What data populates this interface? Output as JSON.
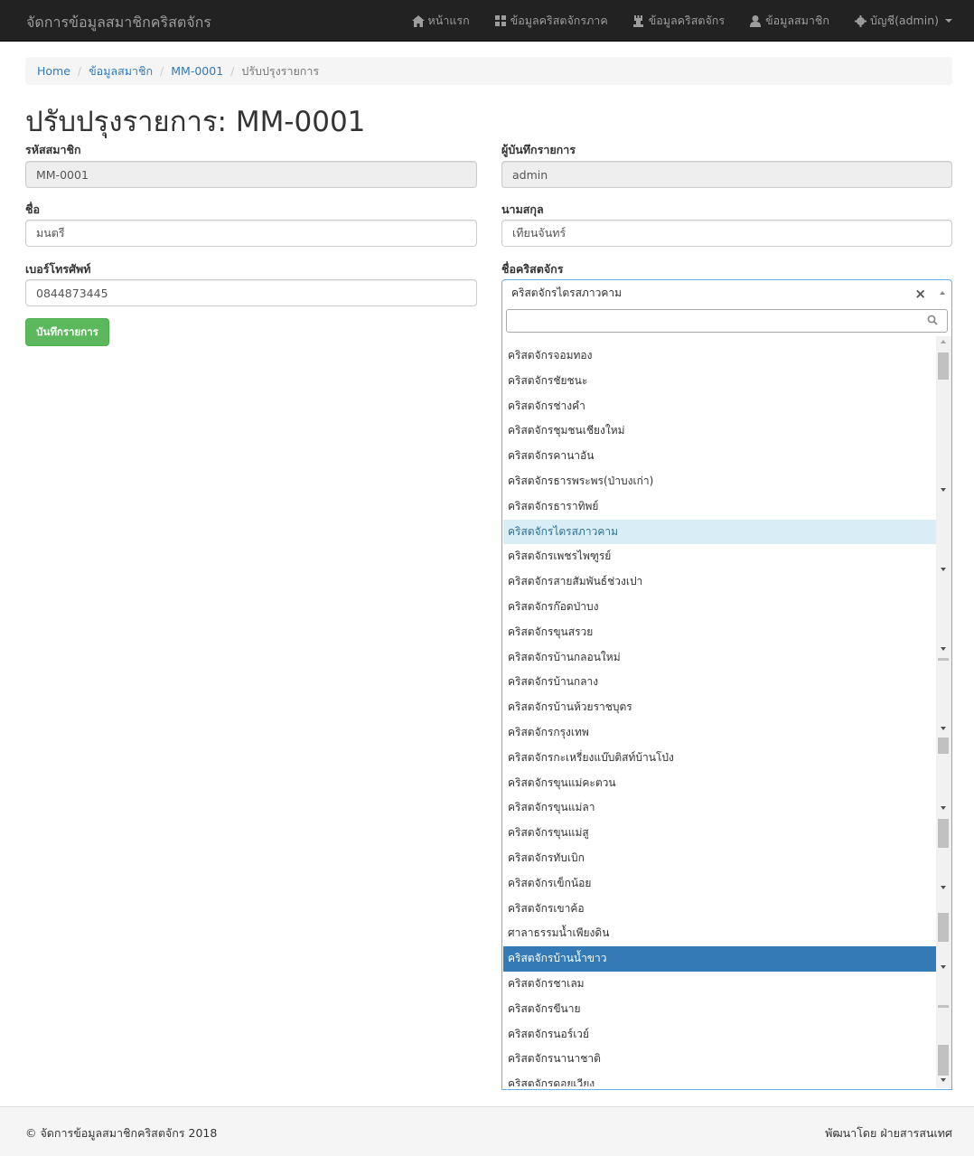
{
  "navbar": {
    "brand": "จัดการข้อมูลสมาชิกคริสตจักร",
    "items": [
      {
        "label": "หน้าแรก",
        "icon": "home-icon"
      },
      {
        "label": "ข้อมูลคริสตจักรภาค",
        "icon": "grid-icon"
      },
      {
        "label": "ข้อมูลคริสตจักร",
        "icon": "tower-icon"
      },
      {
        "label": "ข้อมูลสมาชิก",
        "icon": "user-icon"
      },
      {
        "label": "บัญชี(admin)",
        "icon": "cog-icon"
      }
    ]
  },
  "breadcrumb": {
    "home": "Home",
    "members": "ข้อมูลสมาชิก",
    "record": "MM-0001",
    "current": "ปรับปรุงรายการ",
    "separator": "/"
  },
  "page_title": "ปรับปรุงรายการ: MM-0001",
  "form": {
    "member_id_label": "รหัสสมาชิก",
    "member_id_value": "MM-0001",
    "recorder_label": "ผู้บันทึกรายการ",
    "recorder_value": "admin",
    "first_name_label": "ชื่อ",
    "first_name_value": "มนตรี",
    "last_name_label": "นามสกุล",
    "last_name_value": "เทียนจันทร์",
    "phone_label": "เบอร์โทรศัพท์",
    "phone_value": "0844873445",
    "church_label": "ชื่อคริสตจักร",
    "church_value": "คริสตจักรไตรสภาวคาม",
    "clear_symbol": "×",
    "save_button": "บันทึกรายการ"
  },
  "church_options": [
    "คริสตจักรจอมทอง",
    "คริสตจักรชัยชนะ",
    "คริสตจักรช่างคำ",
    "คริสตจักรชุมชนเชียงใหม่",
    "คริสตจักรคานาอัน",
    "คริสตจักรธารพระพร(ป่าบงเก่า)",
    "คริสตจักรธาราทิพย์",
    "คริสตจักรไตรสภาวคาม",
    "คริสตจักรเพชรไพฑูรย์",
    "คริสตจักรสายสัมพันธ์ช่วงเปา",
    "คริสตจักรก๊อดป่าบง",
    "คริสตจักรขุนสรวย",
    "คริสตจักรบ้านกลอนใหม่",
    "คริสตจักรบ้านกลาง",
    "คริสตจักรบ้านห้วยราชบุตร",
    "คริสตจักรกรุงเทพ",
    "คริสตจักรกะเหรี่ยงแบ๊บติสท์บ้านโป่ง",
    "คริสตจักรขุนแม่คะตวน",
    "คริสตจักรขุนแม่ลา",
    "คริสตจักรขุนแม่สู",
    "คริสตจักรทับเบิก",
    "คริสตจักรเข็กน้อย",
    "คริสตจักรเขาค้อ",
    "ศาลาธรรมน้ำเพียงดิน",
    "คริสตจักรบ้านน้ำขาว",
    "คริสตจักรชาเลม",
    "คริสตจักรขีนาย",
    "คริสตจักรนอร์เวย์",
    "คริสตจักรนานาชาติ",
    "คริสตจักรดอยเวียง"
  ],
  "highlighted_option": "คริสตจักรไตรสภาวคาม",
  "focused_option": "คริสตจักรบ้านน้ำขาว",
  "footer": {
    "left": "© จัดการข้อมูลสมาชิกคริสตจักร 2018",
    "right": "พัฒนาโดย ฝ่ายสารสนเทศ"
  },
  "colors": {
    "navbar_bg": "#222222",
    "link": "#337ab7",
    "save_button": "#5cb85c",
    "option_highlight": "#d9edf7",
    "option_selected": "#337ab7",
    "focus_border": "#66afe9"
  }
}
